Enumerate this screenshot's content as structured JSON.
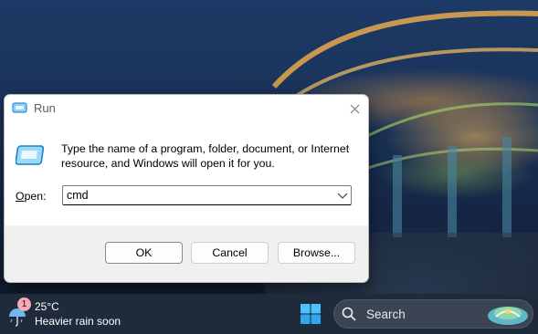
{
  "dialog": {
    "title": "Run",
    "description": "Type the name of a program, folder, document, or Internet resource, and Windows will open it for you.",
    "open_label_accel": "O",
    "open_label_rest": "pen:",
    "input_value": "cmd",
    "buttons": {
      "ok": "OK",
      "cancel": "Cancel",
      "browse": "Browse..."
    }
  },
  "taskbar": {
    "weather": {
      "badge_count": "1",
      "temperature": "25°C",
      "forecast": "Heavier rain soon"
    },
    "search_label": "Search"
  },
  "colors": {
    "taskbar_bg": "#1f2b3b",
    "dialog_bg": "#f0f0f0",
    "accent": "#2f8fd8"
  }
}
